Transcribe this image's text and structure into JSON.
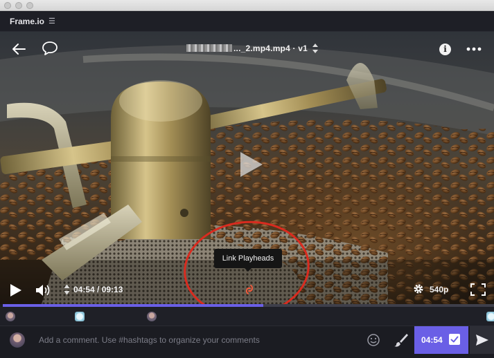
{
  "app": {
    "name": "Frame.io",
    "menu_icon": "hamburger-icon"
  },
  "player": {
    "file_title": "..._2.mp4.mp4 · v1",
    "current_time": "04:54",
    "duration": "09:13",
    "timecode": "04:54 / 09:13",
    "quality": "540p",
    "progress_fraction": 0.53,
    "tooltip": "Link Playheads"
  },
  "comment_bar": {
    "placeholder": "Add a comment. Use #hashtags to organize your comments",
    "timestamp": "04:54",
    "timestamp_checked": true
  },
  "colors": {
    "accent": "#6a5fe6",
    "annotation_circle": "#d92b1f",
    "background": "#1b1c22"
  }
}
